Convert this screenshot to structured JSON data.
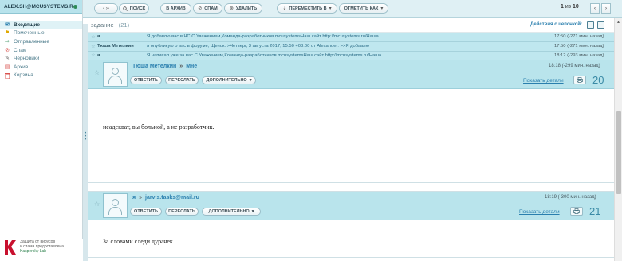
{
  "account": {
    "name": "ALEX.SH@MCUSYSTEMS.R"
  },
  "folders": [
    {
      "label": "Входящие",
      "icon": "inbox-icon",
      "glyph": "✉",
      "color": "#2a7fae"
    },
    {
      "label": "Помеченные",
      "icon": "flag-icon",
      "glyph": "⚑",
      "color": "#e0a800"
    },
    {
      "label": "Отправленные",
      "icon": "sent-icon",
      "glyph": "⇨",
      "color": "#2e8b57"
    },
    {
      "label": "Спам",
      "icon": "spam-icon",
      "glyph": "⊘",
      "color": "#d9534f"
    },
    {
      "label": "Черновики",
      "icon": "drafts-icon",
      "glyph": "✎",
      "color": "#666666"
    },
    {
      "label": "Архив",
      "icon": "archive-icon",
      "glyph": "▤",
      "color": "#d9534f"
    },
    {
      "label": "Корзина",
      "icon": "trash-icon",
      "glyph": "🗑",
      "color": "#d9534f"
    }
  ],
  "kaspersky": {
    "line1": "Защита от вирусов",
    "line2": "и спама предоставлена",
    "brand": "Kaspersky Lab"
  },
  "toolbar": {
    "nav": "‹ ››",
    "search": "ПОИСК",
    "archive": "В АРХИВ",
    "spam": "СПАМ",
    "delete": "УДАЛИТЬ",
    "move": "ПЕРЕМЕСТИТЬ В",
    "mark": "ОТМЕТИТЬ КАК",
    "pager_current": "1",
    "pager_sep": "из",
    "pager_total": "10",
    "prev": "‹",
    "next": "›"
  },
  "thread": {
    "subject": "задание",
    "count": "(21)",
    "chain_actions": "Действия с цепочкой:"
  },
  "collapsed": [
    {
      "from": "я",
      "snippet": "Я добавлю вас в ЧС С Уважением,Команда-разработчиков mcusystemsНаш сайт http://mcusystems.ru/Наша",
      "time": "17:50 (-271 мин. назад)"
    },
    {
      "from": "Тюша Метелкин",
      "snippet": "я опубликую о вас в форуме, Щенок. >Четверг, 3 августа 2017, 15:50 +03:00 от Alexander: >>Я добавлю",
      "time": "17:50 (-271 мин. назад)"
    },
    {
      "from": "я",
      "snippet": "Я написал уже за вас.С Уважением,Команда-разработчиков mcusystemsНаш сайт http://mcusystems.ru/Наша",
      "time": "18:12 (-293 мин. назад)"
    }
  ],
  "messages": [
    {
      "from": "Тюша Метелкин",
      "arrow": "»",
      "to": "Мне",
      "time": "18:18 (-299 мин. назад)",
      "reply": "ОТВЕТИТЬ",
      "forward": "ПЕРЕСЛАТЬ",
      "more": "ДОПОЛНИТЕЛЬНО",
      "details": "Показать детали",
      "num": "20",
      "body": "неадекват, вы больной, а не разработчик."
    },
    {
      "from": "я",
      "arrow": "»",
      "to": "jarvis.tasks@mail.ru",
      "time": "18:19 (-300 мин. назад)",
      "reply": "ОТВЕТИТЬ",
      "forward": "ПЕРЕСЛАТЬ",
      "more": "ДОПОЛНИТЕЛЬНО",
      "details": "Показать детали",
      "num": "21",
      "body": "За словами следи дурачек."
    }
  ]
}
